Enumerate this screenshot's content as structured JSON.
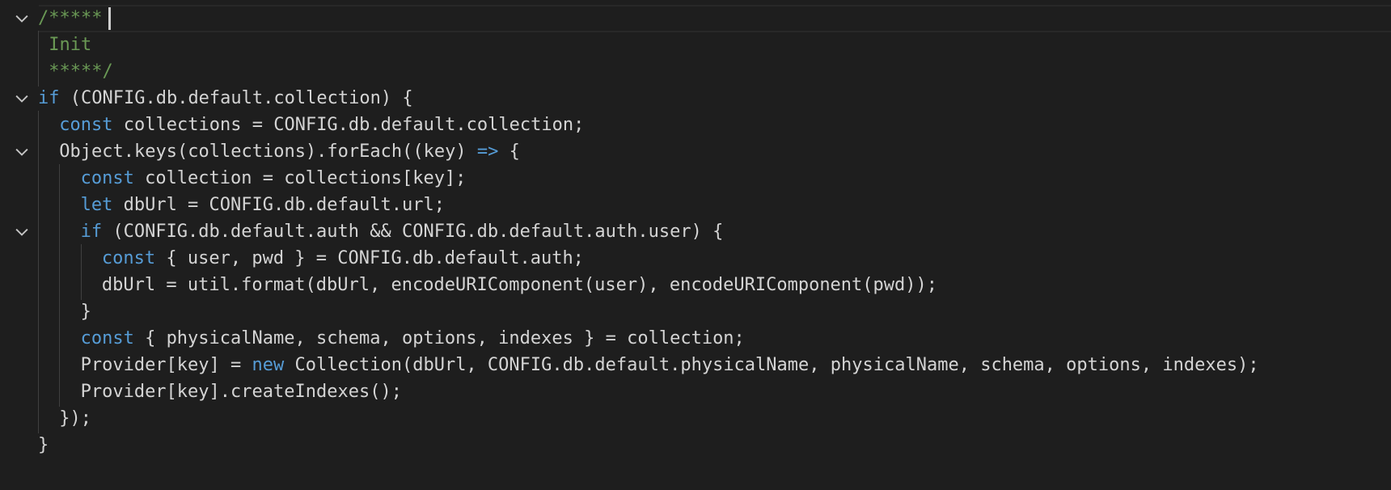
{
  "editor": {
    "language": "javascript",
    "theme_colors": {
      "background": "#1e1e1e",
      "text": "#d4d4d4",
      "keyword": "#569cd6",
      "comment": "#6a9955",
      "indent_guide": "#404040"
    },
    "lines": [
      {
        "indent": 0,
        "fold": true,
        "tokens": [
          {
            "t": "/*****",
            "c": "cm"
          }
        ]
      },
      {
        "indent": 0,
        "fold": false,
        "tokens": [
          {
            "t": " Init",
            "c": "cm"
          }
        ]
      },
      {
        "indent": 0,
        "fold": false,
        "tokens": [
          {
            "t": " *****/",
            "c": "cm"
          }
        ]
      },
      {
        "indent": 0,
        "fold": true,
        "tokens": [
          {
            "t": "if",
            "c": "kw"
          },
          {
            "t": " (CONFIG.db.default.collection) {",
            "c": "pl"
          }
        ]
      },
      {
        "indent": 1,
        "fold": false,
        "tokens": [
          {
            "t": "const",
            "c": "kw"
          },
          {
            "t": " collections = CONFIG.db.default.collection;",
            "c": "pl"
          }
        ]
      },
      {
        "indent": 1,
        "fold": true,
        "tokens": [
          {
            "t": "Object.keys(collections).forEach((key) ",
            "c": "pl"
          },
          {
            "t": "=>",
            "c": "kw"
          },
          {
            "t": " {",
            "c": "pl"
          }
        ]
      },
      {
        "indent": 2,
        "fold": false,
        "tokens": [
          {
            "t": "const",
            "c": "kw"
          },
          {
            "t": " collection = collections[key];",
            "c": "pl"
          }
        ]
      },
      {
        "indent": 2,
        "fold": false,
        "tokens": [
          {
            "t": "let",
            "c": "kw"
          },
          {
            "t": " dbUrl = CONFIG.db.default.url;",
            "c": "pl"
          }
        ]
      },
      {
        "indent": 2,
        "fold": true,
        "tokens": [
          {
            "t": "if",
            "c": "kw"
          },
          {
            "t": " (CONFIG.db.default.auth && CONFIG.db.default.auth.user) {",
            "c": "pl"
          }
        ]
      },
      {
        "indent": 3,
        "fold": false,
        "tokens": [
          {
            "t": "const",
            "c": "kw"
          },
          {
            "t": " { user, pwd } = CONFIG.db.default.auth;",
            "c": "pl"
          }
        ]
      },
      {
        "indent": 3,
        "fold": false,
        "tokens": [
          {
            "t": "dbUrl = util.format(dbUrl, encodeURIComponent(user), encodeURIComponent(pwd));",
            "c": "pl"
          }
        ]
      },
      {
        "indent": 2,
        "fold": false,
        "tokens": [
          {
            "t": "}",
            "c": "pl"
          }
        ]
      },
      {
        "indent": 2,
        "fold": false,
        "tokens": [
          {
            "t": "const",
            "c": "kw"
          },
          {
            "t": " { physicalName, schema, options, indexes } = collection;",
            "c": "pl"
          }
        ]
      },
      {
        "indent": 2,
        "fold": false,
        "tokens": [
          {
            "t": "Provider[key] = ",
            "c": "pl"
          },
          {
            "t": "new",
            "c": "kw"
          },
          {
            "t": " Collection(dbUrl, CONFIG.db.default.physicalName, physicalName, schema, options, indexes);",
            "c": "pl"
          }
        ]
      },
      {
        "indent": 2,
        "fold": false,
        "tokens": [
          {
            "t": "Provider[key].createIndexes();",
            "c": "pl"
          }
        ]
      },
      {
        "indent": 1,
        "fold": false,
        "tokens": [
          {
            "t": "});",
            "c": "pl"
          }
        ]
      },
      {
        "indent": 0,
        "fold": false,
        "tokens": [
          {
            "t": "}",
            "c": "pl"
          }
        ]
      }
    ]
  }
}
